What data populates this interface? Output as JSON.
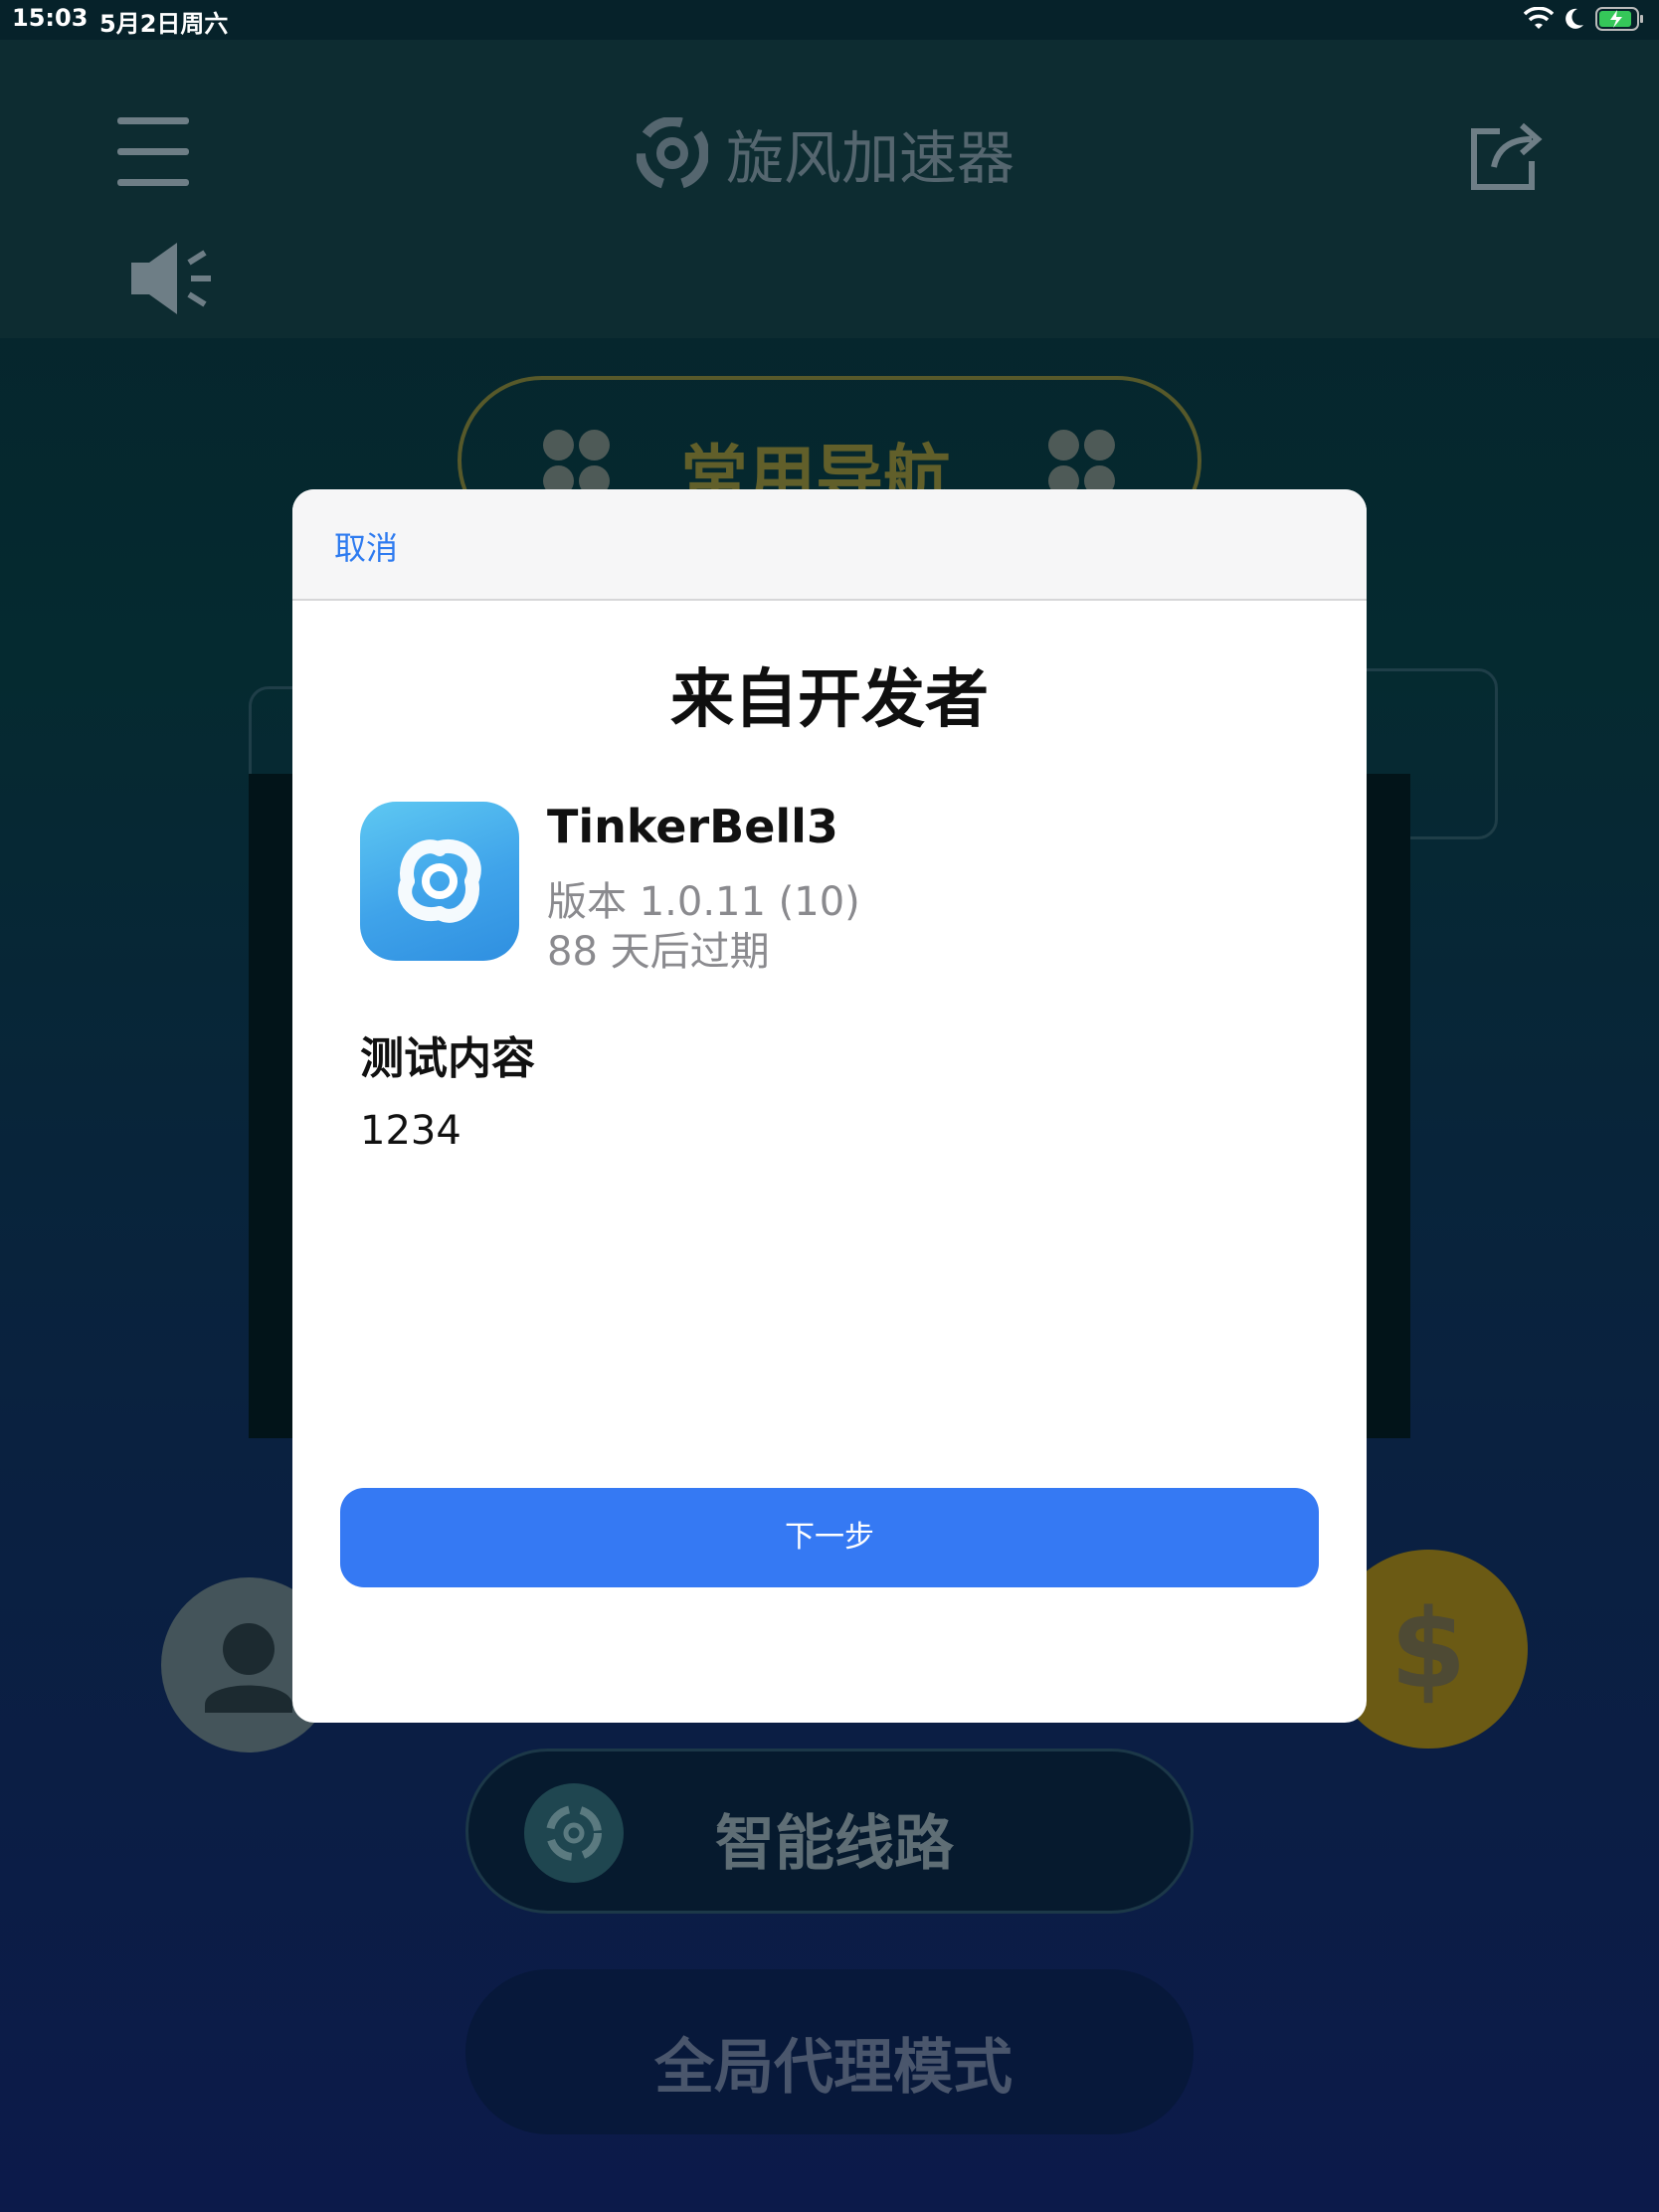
{
  "status_bar": {
    "time": "15:03",
    "date": "5月2日周六",
    "icons": [
      "wifi-icon",
      "moon-icon",
      "battery-charging-icon"
    ]
  },
  "background_app": {
    "title": "旋风加速器",
    "nav_label": "常用导航",
    "route_label": "智能线路",
    "mode_label": "全局代理模式",
    "dollar_symbol": "$"
  },
  "modal": {
    "cancel_label": "取消",
    "title": "来自开发者",
    "app": {
      "name": "TinkerBell3",
      "version": "版本 1.0.11 (10)",
      "expiry": "88 天后过期"
    },
    "section_title": "测试内容",
    "section_body": "1234",
    "next_label": "下一步"
  },
  "colors": {
    "accent": "#3579f3",
    "link": "#2e7bf0",
    "secondary_text": "#8a8a8e"
  }
}
